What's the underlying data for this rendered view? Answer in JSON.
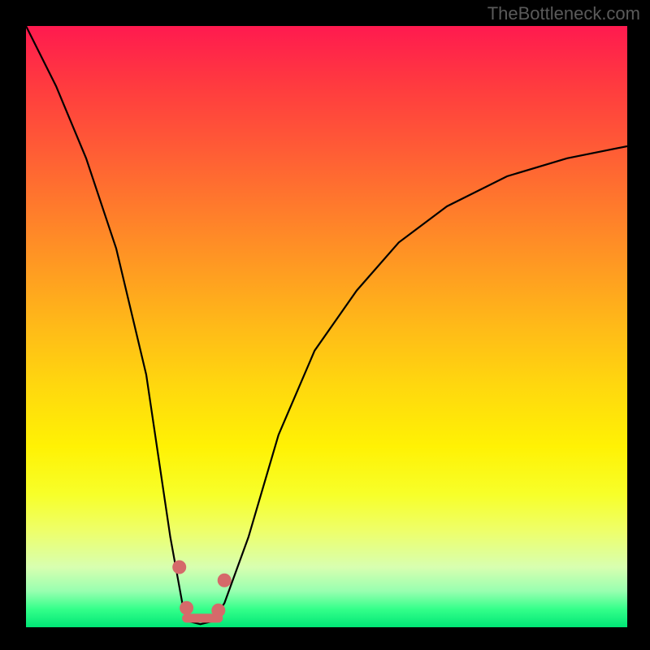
{
  "watermark": "TheBottleneck.com",
  "chart_data": {
    "type": "line",
    "title": "",
    "xlabel": "",
    "ylabel": "",
    "xlim": [
      0,
      100
    ],
    "ylim": [
      0,
      100
    ],
    "grid": false,
    "legend": false,
    "series": [
      {
        "name": "bottleneck-curve",
        "x": [
          0,
          5,
          10,
          15,
          20,
          24,
          26,
          27,
          29,
          31,
          33,
          37,
          42,
          48,
          55,
          62,
          70,
          80,
          90,
          100
        ],
        "y": [
          100,
          90,
          78,
          63,
          42,
          15,
          4,
          1,
          0.5,
          1,
          4,
          15,
          32,
          46,
          56,
          64,
          70,
          75,
          78,
          80
        ]
      }
    ],
    "markers": [
      {
        "name": "left-upper",
        "x": 25.5,
        "y": 10
      },
      {
        "name": "left-lower",
        "x": 26.7,
        "y": 3.2
      },
      {
        "name": "right-lower",
        "x": 32.0,
        "y": 2.8
      },
      {
        "name": "right-upper",
        "x": 33.0,
        "y": 7.8
      }
    ],
    "flat_segment": {
      "x0": 26.7,
      "x1": 32.0,
      "y": 1.5
    }
  },
  "colors": {
    "marker": "#d56a6a",
    "curve": "#000000",
    "bg_top": "#ff1a4f",
    "bg_bottom": "#00e676"
  }
}
